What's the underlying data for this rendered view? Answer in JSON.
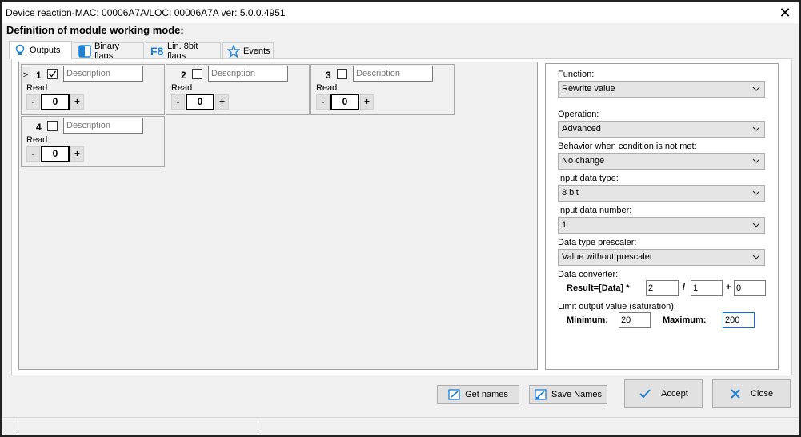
{
  "window": {
    "title": "Device reaction-MAC: 00006A7A/LOC: 00006A7A ver: 5.0.0.4951",
    "close_glyph": "✕"
  },
  "heading": "Definition of module working mode:",
  "tabs": [
    {
      "label": "Outputs",
      "icon": "lightbulb-icon"
    },
    {
      "label": "Binary flags",
      "icon": "binary-flag-icon"
    },
    {
      "label": "Lin. 8bit flags",
      "icon": "f8-icon",
      "icon_text": "F8"
    },
    {
      "label": "Events",
      "icon": "star-icon"
    }
  ],
  "outputs": [
    {
      "number": "1",
      "checked": true,
      "marker": ">",
      "description_placeholder": "Description",
      "mode": "Read",
      "value": "0"
    },
    {
      "number": "2",
      "checked": false,
      "description_placeholder": "Description",
      "mode": "Read",
      "value": "0"
    },
    {
      "number": "3",
      "checked": false,
      "description_placeholder": "Description",
      "mode": "Read",
      "value": "0"
    },
    {
      "number": "4",
      "checked": false,
      "description_placeholder": "Description",
      "mode": "Read",
      "value": "0"
    }
  ],
  "stepper": {
    "minus": "-",
    "plus": "+"
  },
  "settings": {
    "function_label": "Function:",
    "function_value": "Rewrite value",
    "operation_label": "Operation:",
    "operation_value": "Advanced",
    "behavior_label": "Behavior when condition is not met:",
    "behavior_value": "No change",
    "input_type_label": "Input data type:",
    "input_type_value": "8 bit",
    "input_number_label": "Input data number:",
    "input_number_value": "1",
    "prescaler_label": "Data type prescaler:",
    "prescaler_value": "Value without prescaler",
    "converter_label": "Data converter:",
    "result_label": "Result=[Data] *",
    "multiplier": "2",
    "divide_sign": "/",
    "divisor": "1",
    "plus_sign": "+",
    "offset": "0",
    "limit_label": "Limit output value (saturation):",
    "minimum_label": "Minimum:",
    "minimum_value": "20",
    "maximum_label": "Maximum:",
    "maximum_value": "200"
  },
  "buttons": {
    "get_names": "Get names",
    "save_names": "Save Names",
    "accept": "Accept",
    "close": "Close"
  },
  "colors": {
    "accent_blue": "#1e7fd6",
    "close_red": "#d83b3b"
  }
}
